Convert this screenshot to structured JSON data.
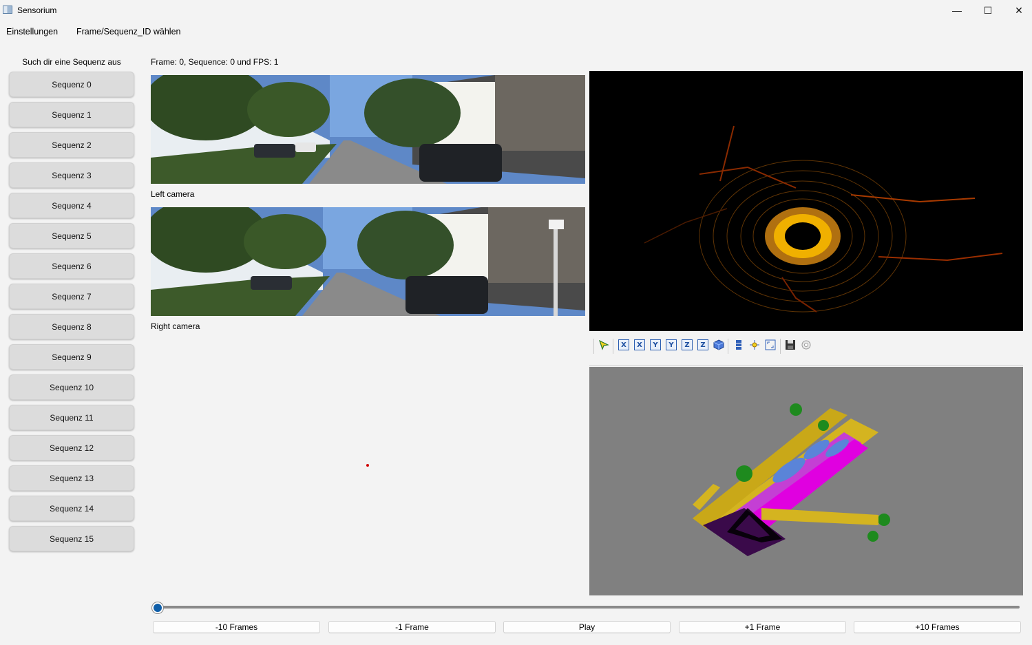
{
  "window": {
    "title": "Sensorium",
    "controls": [
      "—",
      "☐",
      "✕"
    ]
  },
  "menu": {
    "items": [
      "Einstellungen",
      "Frame/Sequenz_ID wählen"
    ]
  },
  "sidebar": {
    "title": "Such dir eine Sequenz aus",
    "sequences": [
      "Sequenz 0",
      "Sequenz 1",
      "Sequenz 2",
      "Sequenz 3",
      "Sequenz 4",
      "Sequenz 5",
      "Sequenz 6",
      "Sequenz 7",
      "Sequenz 8",
      "Sequenz 9",
      "Sequenz 10",
      "Sequenz 11",
      "Sequenz 12",
      "Sequenz 13",
      "Sequenz 14",
      "Sequenz 15"
    ]
  },
  "main": {
    "frame_info": "Frame: 0, Sequence: 0 und FPS: 1",
    "left_camera_label": "Left camera",
    "right_camera_label": "Right camera"
  },
  "toolbar": {
    "icons": [
      "pick-icon",
      "view-x-pos-icon",
      "view-x-neg-icon",
      "view-y-pos-icon",
      "view-y-neg-icon",
      "view-z-pos-icon",
      "view-z-neg-icon",
      "iso-view-icon",
      "layers-icon",
      "pivot-icon",
      "zoom-fit-icon",
      "save-icon",
      "settings-icon"
    ],
    "axis_letters": [
      "X",
      "X",
      "Y",
      "Y",
      "Z",
      "Z"
    ]
  },
  "playback": {
    "slider_value": 0,
    "buttons": [
      "-10 Frames",
      "-1 Frame",
      "Play",
      "+1 Frame",
      "+10 Frames"
    ]
  },
  "colors": {
    "window_bg": "#f3f3f3",
    "sequence_button": "#dcdcdc",
    "lidar_bg": "#000000",
    "view3d_bg": "#808080",
    "slider_handle": "#0f5ea8"
  }
}
